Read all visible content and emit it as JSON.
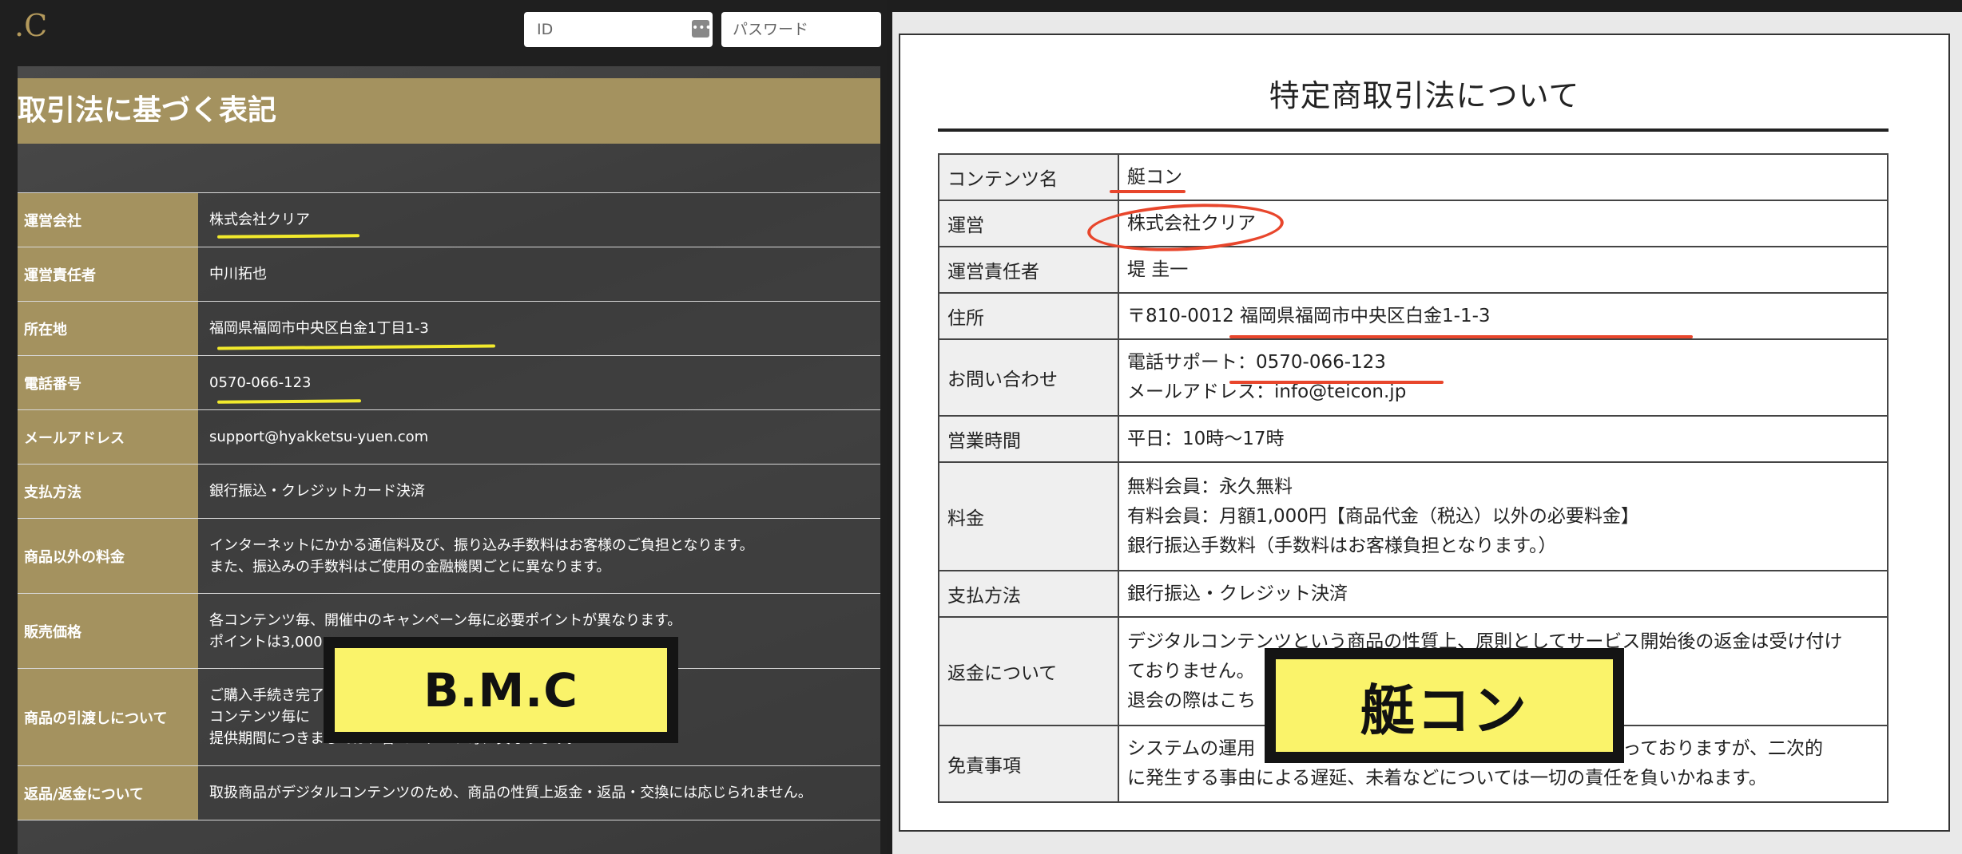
{
  "header": {
    "logo": ".C",
    "id_placeholder": "ID",
    "password_placeholder": "パスワード"
  },
  "left": {
    "heading": "取引法に基づく表記",
    "rows": [
      {
        "label": "運営会社",
        "lines": [
          "株式会社クリア"
        ]
      },
      {
        "label": "運営責任者",
        "lines": [
          "中川拓也"
        ]
      },
      {
        "label": "所在地",
        "lines": [
          "福岡県福岡市中央区白金1丁目1-3"
        ]
      },
      {
        "label": "電話番号",
        "lines": [
          "0570-066-123"
        ]
      },
      {
        "label": "メールアドレス",
        "lines": [
          "support@hyakketsu-yuen.com"
        ]
      },
      {
        "label": "支払方法",
        "lines": [
          "銀行振込・クレジットカード決済"
        ]
      },
      {
        "label": "商品以外の料金",
        "lines": [
          "インターネットにかかる通信料及び、振り込み手数料はお客様のご負担となります。",
          "また、振込みの手数料はご使用の金融機関ごとに異なります。"
        ]
      },
      {
        "label": "販売価格",
        "lines": [
          "各コンテンツ毎、開催中のキャンペーン毎に必要ポイントが異なります。",
          "ポイントは3,000"
        ]
      },
      {
        "label": "商品の引渡しについて",
        "lines": [
          "ご購入手続き完了",
          "コンテンツ毎に",
          "提供期間につきましては、各コンテンツ毎に異なります。"
        ]
      },
      {
        "label": "返品/返金について",
        "lines": [
          "取扱商品がデジタルコンテンツのため、商品の性質上返金・返品・交換には応じられません。"
        ]
      }
    ],
    "sticker": "B.M.C"
  },
  "right": {
    "title": "特定商取引法について",
    "rows": [
      {
        "label": "コンテンツ名",
        "lines": [
          "艇コン"
        ]
      },
      {
        "label": "運営",
        "lines": [
          "株式会社クリア"
        ]
      },
      {
        "label": "運営責任者",
        "lines": [
          "堤 圭一"
        ]
      },
      {
        "label": "住所",
        "lines": [
          "〒810-0012 福岡県福岡市中央区白金1-1-3"
        ]
      },
      {
        "label": "お問い合わせ",
        "lines": [
          "電話サポート：0570-066-123",
          "メールアドレス：info@teicon.jp"
        ]
      },
      {
        "label": "営業時間",
        "lines": [
          "平日：10時〜17時"
        ]
      },
      {
        "label": "料金",
        "lines": [
          "無料会員：永久無料",
          "有料会員：月額1,000円【商品代金（税込）以外の必要料金】",
          "銀行振込手数料（手数料はお客様負担となります。）"
        ]
      },
      {
        "label": "支払方法",
        "lines": [
          "銀行振込・クレジット決済"
        ]
      },
      {
        "label": "返金について",
        "lines": [
          "デジタルコンテンツという商品の性質上、原則としてサービス開始後の返金は受け付け",
          "ておりません。",
          "退会の際はこち"
        ]
      },
      {
        "label": "免責事項",
        "lines": [
          "システムの運用　　　　　　　　　　　　　　　　注意を払っておりますが、二次的",
          "に発生する事由による遅延、未着などについては一切の責任を負いかねます。"
        ]
      }
    ],
    "sticker": "艇コン"
  },
  "colors": {
    "gold": "#a4925f",
    "highlight_yellow": "#f2ea2c",
    "highlight_red": "#e8462c",
    "sticker_yellow": "#faf36a"
  }
}
